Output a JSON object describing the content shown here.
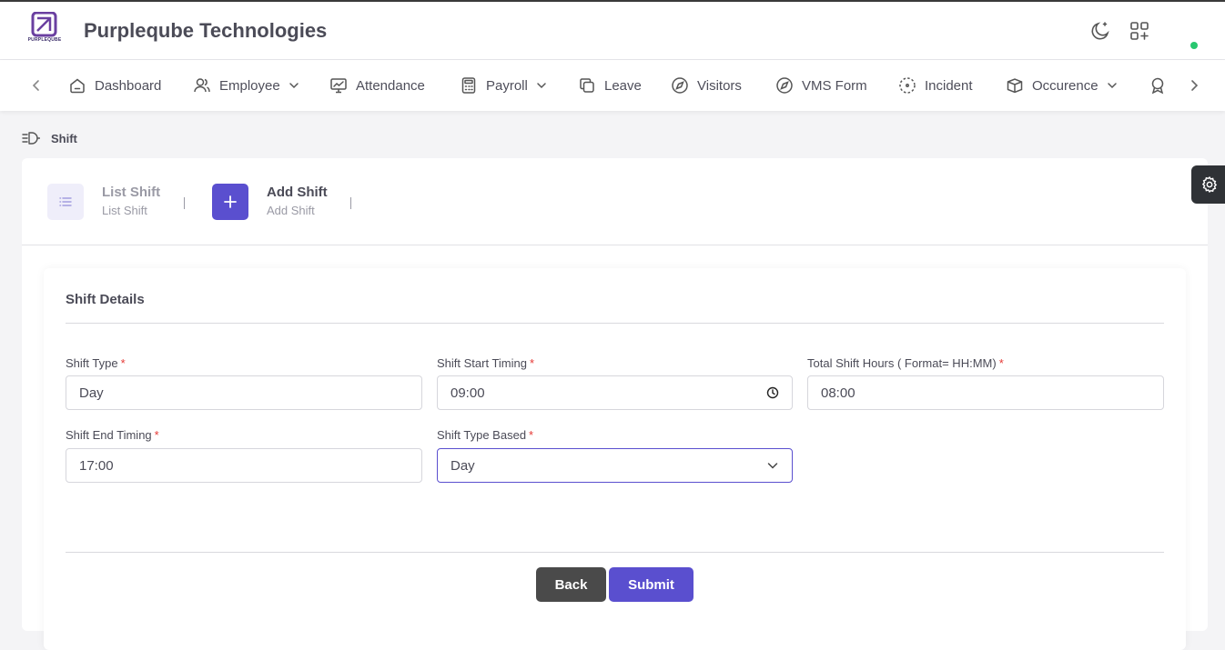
{
  "header": {
    "logo_text": "PURPLEQUBE",
    "company_name": "Purpleqube Technologies",
    "theme_icon": "moon-icon",
    "apps_icon": "grid-plus-icon",
    "status_color": "#28c76f"
  },
  "nav": {
    "items": [
      {
        "label": "Dashboard",
        "icon": "home-icon"
      },
      {
        "label": "Employee",
        "icon": "users-icon",
        "dropdown": true
      },
      {
        "label": "Attendance",
        "icon": "monitor-chart-icon"
      },
      {
        "label": "Payroll",
        "icon": "calculator-icon",
        "dropdown": true
      },
      {
        "label": "Leave",
        "icon": "copy-icon"
      },
      {
        "label": "Visitors",
        "icon": "compass-icon"
      },
      {
        "label": "VMS Form",
        "icon": "compass-icon"
      },
      {
        "label": "Incident",
        "icon": "focus-icon"
      },
      {
        "label": "Occurence",
        "icon": "box-icon",
        "dropdown": true
      }
    ]
  },
  "breadcrumb": {
    "label": "Shift"
  },
  "tabs": [
    {
      "title": "List Shift",
      "subtitle": "List Shift",
      "active": false
    },
    {
      "title": "Add Shift",
      "subtitle": "Add Shift",
      "active": true
    }
  ],
  "form": {
    "section_title": "Shift Details",
    "required_mark": "*",
    "fields": {
      "shift_type": {
        "label": "Shift Type",
        "value": "Day"
      },
      "shift_start": {
        "label": "Shift Start Timing",
        "value": "09:00"
      },
      "total_hours": {
        "label": "Total Shift Hours ( Format= HH:MM)",
        "value": "08:00"
      },
      "shift_end": {
        "label": "Shift End Timing",
        "value": "17:00"
      },
      "type_based": {
        "label": "Shift Type Based",
        "value": "Day"
      }
    },
    "back_label": "Back",
    "submit_label": "Submit"
  },
  "colors": {
    "accent": "#5a4fcf",
    "back_button": "#4a4a4a",
    "required": "#e53935"
  }
}
